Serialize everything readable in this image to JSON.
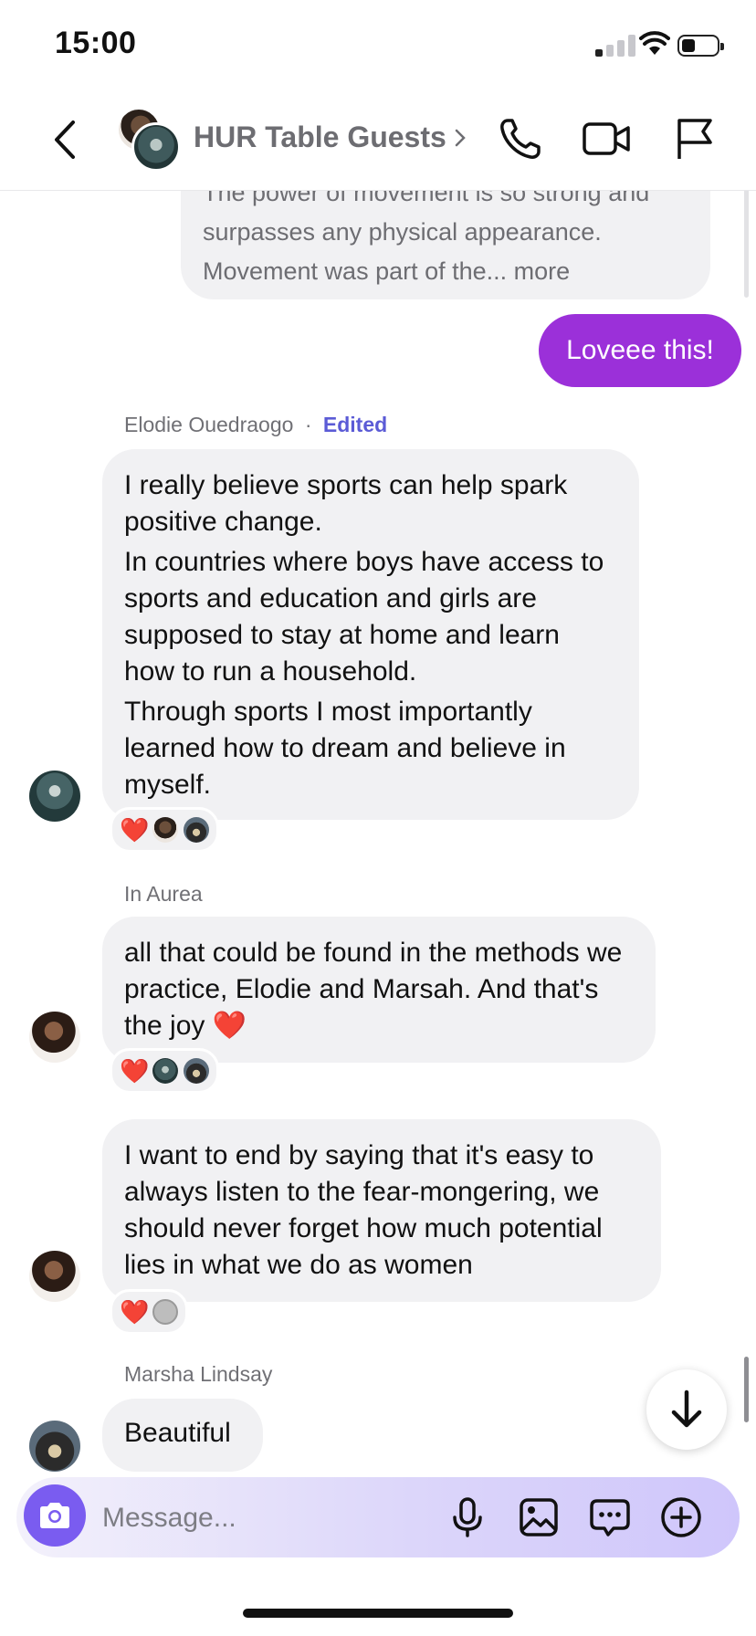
{
  "status_bar": {
    "time": "15:00"
  },
  "header": {
    "title": "HUR Table Guests"
  },
  "messages": {
    "forwarded_preview": {
      "line1": "The power of movement is so strong and",
      "line2": "surpasses any physical appearance.",
      "line3": "Movement was part of the... more"
    },
    "outgoing": {
      "text": "Loveee this!"
    },
    "elodie": {
      "sender": "Elodie Ouedraogo",
      "separator": "·",
      "edited": "Edited",
      "para1": "I really believe sports can help spark positive change.",
      "para2": "In countries where boys have access to sports and education and girls are supposed to stay at home and learn how to run a household.",
      "para3": "Through sports I most importantly learned how to dream and believe in myself."
    },
    "aurea1": {
      "sender": "In Aurea",
      "text": "all that could be found in the methods we practice, Elodie and Marsah. And that's the joy ❤️"
    },
    "aurea2": {
      "text": "I want to end by saying that it's easy to always listen to the fear-mongering, we should never forget how much potential lies in what we do as women"
    },
    "marsha": {
      "sender": "Marsha Lindsay",
      "text": "Beautiful"
    }
  },
  "reactions": {
    "heart": "❤️"
  },
  "composer": {
    "placeholder": "Message..."
  },
  "colors": {
    "outgoing_bubble": "#9b30d9",
    "incoming_bubble": "#f1f1f3",
    "accent": "#7a5cf0",
    "edited": "#5b5bd6"
  }
}
